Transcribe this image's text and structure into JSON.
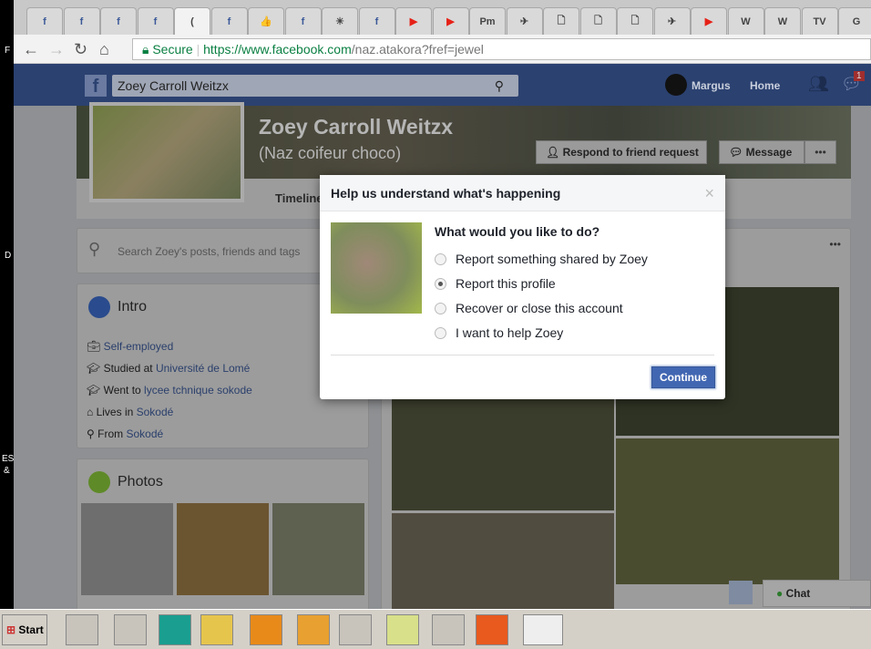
{
  "left_strip": {
    "chars": [
      "F",
      "D",
      "ES",
      "&"
    ]
  },
  "tabs": [
    "f",
    "f",
    "f",
    "f",
    "(",
    "f",
    "👍",
    "f",
    "☀",
    "f",
    "▶",
    "▶",
    "Pm",
    "✈",
    "🗋",
    "🗋",
    "🗋",
    "✈",
    "▶",
    "W",
    "W",
    "TV",
    "G",
    "●"
  ],
  "address": {
    "secure": "Secure",
    "url_host": "https://www.facebook.com",
    "url_path": "/naz.atakora?fref=jewel"
  },
  "fb": {
    "search_value": "Zoey Carroll Weitzx",
    "user": "Margus",
    "home": "Home",
    "notif_count": "1"
  },
  "profile": {
    "name": "Zoey Carroll Weitzx",
    "alt_name": "(Naz coifeur choco)",
    "respond": "Respond to friend request",
    "message": "Message",
    "more": "•••",
    "timeline_tab": "Timeline"
  },
  "left": {
    "search_placeholder": "Search Zoey's posts, friends and tags",
    "intro_title": "Intro",
    "intro": [
      {
        "pre": "",
        "link": "Self-employed"
      },
      {
        "pre": "Studied at ",
        "link": "Université de Lomé"
      },
      {
        "pre": "Went to ",
        "link": "lycee tchnique sokode"
      },
      {
        "pre": "Lives in ",
        "link": "Sokodé"
      },
      {
        "pre": "From ",
        "link": "Sokodé"
      }
    ],
    "photos_title": "Photos"
  },
  "modal": {
    "title": "Help us understand what's happening",
    "close": "×",
    "question": "What would you like to do?",
    "options": [
      "Report something shared by Zoey",
      "Report this profile",
      "Recover or close this account",
      "I want to help Zoey"
    ],
    "selected": 1,
    "continue": "Continue"
  },
  "chat": {
    "label": "Chat"
  },
  "taskbar": {
    "start": "Start"
  }
}
